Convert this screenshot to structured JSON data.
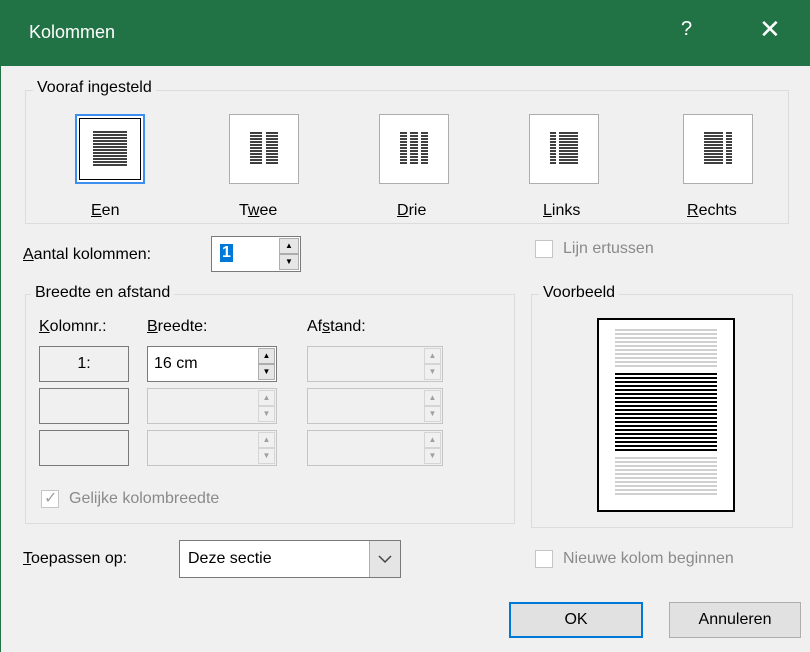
{
  "title": "Kolommen",
  "help_glyph": "?",
  "close_glyph": "✕",
  "presets_legend": "Vooraf ingesteld",
  "presets": [
    {
      "label_u": "E",
      "label_rest": "en"
    },
    {
      "label_pre": "T",
      "label_u": "w",
      "label_rest": "ee"
    },
    {
      "label_u": "D",
      "label_rest": "rie"
    },
    {
      "label_u": "L",
      "label_rest": "inks"
    },
    {
      "label_u": "R",
      "label_rest": "echts"
    }
  ],
  "num_cols_label_u": "A",
  "num_cols_label_rest": "antal kolommen:",
  "num_cols_value": "1",
  "line_between": "Lijn ertussen",
  "width_legend": "Breedte en afstand",
  "col_header_u": "K",
  "col_header_rest": "olomnr.:",
  "width_header_u": "B",
  "width_header_rest": "reedte:",
  "spacing_header_pre": "Af",
  "spacing_header_u": "s",
  "spacing_header_rest": "tand:",
  "rows": [
    {
      "num": "1:",
      "width": "16 cm",
      "spacing": ""
    },
    {
      "num": "",
      "width": "",
      "spacing": ""
    },
    {
      "num": "",
      "width": "",
      "spacing": ""
    }
  ],
  "equal_width": "Gelijke kolombreedte",
  "preview_legend": "Voorbeeld",
  "apply_label_u": "T",
  "apply_label_rest": "oepassen op:",
  "apply_value": "Deze sectie",
  "new_column": "Nieuwe kolom beginnen",
  "ok": "OK",
  "cancel": "Annuleren"
}
